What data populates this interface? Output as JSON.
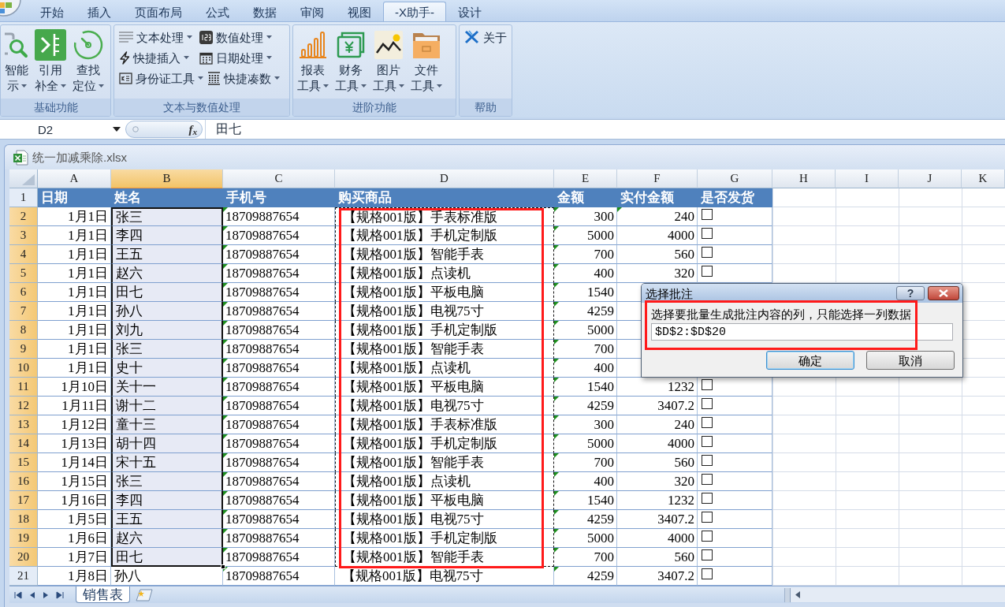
{
  "ribbon": {
    "tabs": [
      {
        "label": "开始",
        "selected": false
      },
      {
        "label": "插入",
        "selected": false
      },
      {
        "label": "页面布局",
        "selected": false
      },
      {
        "label": "公式",
        "selected": false
      },
      {
        "label": "数据",
        "selected": false
      },
      {
        "label": "审阅",
        "selected": false
      },
      {
        "label": "视图",
        "selected": false
      },
      {
        "label": "-X助手-",
        "selected": true
      },
      {
        "label": "设计",
        "selected": false
      }
    ],
    "groups": [
      {
        "title": "基础功能",
        "kind": "large",
        "buttons": [
          {
            "lines": [
              "智能",
              "示"
            ],
            "dropdown": true
          },
          {
            "lines": [
              "引用",
              "补全"
            ],
            "dropdown": true
          },
          {
            "lines": [
              "查找",
              "定位"
            ],
            "dropdown": true
          }
        ]
      },
      {
        "title": "文本与数值处理",
        "kind": "small",
        "buttons": [
          {
            "label": "文本处理",
            "dropdown": true
          },
          {
            "label": "数值处理",
            "dropdown": true
          },
          {
            "label": "快捷插入",
            "dropdown": true
          },
          {
            "label": "日期处理",
            "dropdown": true
          },
          {
            "label": "身份证工具",
            "dropdown": true
          },
          {
            "label": "快捷凑数",
            "dropdown": true
          }
        ]
      },
      {
        "title": "进阶功能",
        "kind": "large",
        "buttons": [
          {
            "lines": [
              "报表",
              "工具"
            ],
            "dropdown": true
          },
          {
            "lines": [
              "财务",
              "工具"
            ],
            "dropdown": true
          },
          {
            "lines": [
              "图片",
              "工具"
            ],
            "dropdown": true
          },
          {
            "lines": [
              "文件",
              "工具"
            ],
            "dropdown": true
          }
        ]
      },
      {
        "title": "帮助",
        "kind": "small",
        "buttons": [
          {
            "label": "关于",
            "dropdown": false
          }
        ]
      }
    ]
  },
  "formula_bar": {
    "name_box": "D2",
    "function_button": "f$_{x}$",
    "formula": "田七"
  },
  "workbook": {
    "title": "统一加减乘除.xlsx"
  },
  "sheet": {
    "columns": [
      {
        "letter": "A",
        "selected": false,
        "copied": false
      },
      {
        "letter": "B",
        "selected": true,
        "copied": false
      },
      {
        "letter": "C",
        "selected": false,
        "copied": false
      },
      {
        "letter": "D",
        "selected": false,
        "copied": true
      },
      {
        "letter": "E",
        "selected": false,
        "copied": false
      },
      {
        "letter": "F",
        "selected": false,
        "copied": false
      },
      {
        "letter": "G",
        "selected": false,
        "copied": false
      },
      {
        "letter": "H",
        "selected": false,
        "copied": false
      },
      {
        "letter": "I",
        "selected": false,
        "copied": false
      },
      {
        "letter": "J",
        "selected": false,
        "copied": false
      },
      {
        "letter": "K",
        "selected": false,
        "copied": false
      }
    ],
    "header_row": {
      "number": "1",
      "selected": false,
      "cells": [
        "日期",
        "姓名",
        "手机号",
        "购买商品",
        "金额",
        "实付金额",
        "是否发货"
      ]
    },
    "rows": [
      {
        "number": "2",
        "selected": true,
        "date": "1月1日",
        "name": "张三",
        "phone": "18709887654",
        "product": "【规格001版】手表标准版",
        "amount": "300",
        "paid": "240",
        "shipped": {
          "checked": false
        },
        "flags": {
          "phone": true,
          "amount": true,
          "paid": true
        }
      },
      {
        "number": "3",
        "selected": true,
        "date": "1月1日",
        "name": "李四",
        "phone": "18709887654",
        "product": "【规格001版】手机定制版",
        "amount": "5000",
        "paid": "4000",
        "shipped": {
          "checked": false
        },
        "flags": {
          "phone": true,
          "amount": true,
          "paid": false
        }
      },
      {
        "number": "4",
        "selected": true,
        "date": "1月1日",
        "name": "王五",
        "phone": "18709887654",
        "product": "【规格001版】智能手表",
        "amount": "700",
        "paid": "560",
        "shipped": {
          "checked": false
        },
        "flags": {
          "phone": true,
          "amount": true,
          "paid": false
        }
      },
      {
        "number": "5",
        "selected": true,
        "date": "1月1日",
        "name": "赵六",
        "phone": "18709887654",
        "product": "【规格001版】点读机",
        "amount": "400",
        "paid": "320",
        "shipped": {
          "checked": false
        },
        "flags": {
          "phone": true,
          "amount": true,
          "paid": false
        }
      },
      {
        "number": "6",
        "selected": true,
        "date": "1月1日",
        "name": "田七",
        "phone": "18709887654",
        "product": "【规格001版】平板电脑",
        "amount": "1540",
        "flags": {
          "phone": true,
          "amount": true,
          "paid": false
        }
      },
      {
        "number": "7",
        "selected": true,
        "date": "1月1日",
        "name": "孙八",
        "phone": "18709887654",
        "product": "【规格001版】电视75寸",
        "amount": "4259",
        "flags": {
          "phone": true,
          "amount": true,
          "paid": false
        }
      },
      {
        "number": "8",
        "selected": true,
        "date": "1月1日",
        "name": "刘九",
        "phone": "18709887654",
        "product": "【规格001版】手机定制版",
        "amount": "5000",
        "flags": {
          "phone": true,
          "amount": true,
          "paid": false
        }
      },
      {
        "number": "9",
        "selected": true,
        "date": "1月1日",
        "name": "张三",
        "phone": "18709887654",
        "product": "【规格001版】智能手表",
        "amount": "700",
        "flags": {
          "phone": true,
          "amount": true,
          "paid": false
        }
      },
      {
        "number": "10",
        "selected": true,
        "date": "1月1日",
        "name": "史十",
        "phone": "18709887654",
        "product": "【规格001版】点读机",
        "amount": "400",
        "flags": {
          "phone": true,
          "amount": true,
          "paid": false
        }
      },
      {
        "number": "11",
        "selected": true,
        "date": "1月10日",
        "name": "关十一",
        "phone": "18709887654",
        "product": "【规格001版】平板电脑",
        "amount": "1540",
        "paid": "1232",
        "shipped": {
          "checked": false
        },
        "flags": {
          "phone": true,
          "amount": true,
          "paid": false
        }
      },
      {
        "number": "12",
        "selected": true,
        "date": "1月11日",
        "name": "谢十二",
        "phone": "18709887654",
        "product": "【规格001版】电视75寸",
        "amount": "4259",
        "paid": "3407.2",
        "shipped": {
          "checked": false
        },
        "flags": {
          "phone": true,
          "amount": true,
          "paid": false
        }
      },
      {
        "number": "13",
        "selected": true,
        "date": "1月12日",
        "name": "童十三",
        "phone": "18709887654",
        "product": "【规格001版】手表标准版",
        "amount": "300",
        "paid": "240",
        "shipped": {
          "checked": false
        },
        "flags": {
          "phone": true,
          "amount": true,
          "paid": false
        }
      },
      {
        "number": "14",
        "selected": true,
        "date": "1月13日",
        "name": "胡十四",
        "phone": "18709887654",
        "product": "【规格001版】手机定制版",
        "amount": "5000",
        "paid": "4000",
        "shipped": {
          "checked": false
        },
        "flags": {
          "phone": true,
          "amount": true,
          "paid": false
        }
      },
      {
        "number": "15",
        "selected": true,
        "date": "1月14日",
        "name": "宋十五",
        "phone": "18709887654",
        "product": "【规格001版】智能手表",
        "amount": "700",
        "paid": "560",
        "shipped": {
          "checked": false
        },
        "flags": {
          "phone": true,
          "amount": true,
          "paid": false
        }
      },
      {
        "number": "16",
        "selected": true,
        "date": "1月15日",
        "name": "张三",
        "phone": "18709887654",
        "product": "【规格001版】点读机",
        "amount": "400",
        "paid": "320",
        "shipped": {
          "checked": false
        },
        "flags": {
          "phone": true,
          "amount": true,
          "paid": false
        }
      },
      {
        "number": "17",
        "selected": true,
        "date": "1月16日",
        "name": "李四",
        "phone": "18709887654",
        "product": "【规格001版】平板电脑",
        "amount": "1540",
        "paid": "1232",
        "shipped": {
          "checked": false
        },
        "flags": {
          "phone": true,
          "amount": true,
          "paid": false
        }
      },
      {
        "number": "18",
        "selected": true,
        "date": "1月5日",
        "name": "王五",
        "phone": "18709887654",
        "product": "【规格001版】电视75寸",
        "amount": "4259",
        "paid": "3407.2",
        "shipped": {
          "checked": false
        },
        "flags": {
          "phone": true,
          "amount": true,
          "paid": false
        }
      },
      {
        "number": "19",
        "selected": true,
        "date": "1月6日",
        "name": "赵六",
        "phone": "18709887654",
        "product": "【规格001版】手机定制版",
        "amount": "5000",
        "paid": "4000",
        "shipped": {
          "checked": false
        },
        "flags": {
          "phone": true,
          "amount": true,
          "paid": false
        }
      },
      {
        "number": "20",
        "selected": true,
        "date": "1月7日",
        "name": "田七",
        "phone": "18709887654",
        "product": "【规格001版】智能手表",
        "amount": "700",
        "paid": "560",
        "shipped": {
          "checked": false
        },
        "flags": {
          "phone": true,
          "amount": true,
          "paid": false
        }
      },
      {
        "number": "21",
        "selected": false,
        "date": "1月8日",
        "name": "孙八",
        "phone": "18709887654",
        "product": "【规格001版】电视75寸",
        "amount": "4259",
        "paid": "3407.2",
        "shipped": {
          "checked": false
        },
        "flags": {
          "phone": true,
          "amount": true,
          "paid": false
        }
      }
    ]
  },
  "sheet_tabs": [
    {
      "label": "销售表",
      "selected": true
    }
  ],
  "dialog": {
    "title": "选择批注",
    "help_button": "?",
    "message": "选择要批量生成批注内容的列，只能选择一列数据",
    "range_value": "$D$2:$D$20",
    "buttons": [
      {
        "label": "确定",
        "focused": true
      },
      {
        "label": "取消",
        "focused": false
      }
    ]
  }
}
